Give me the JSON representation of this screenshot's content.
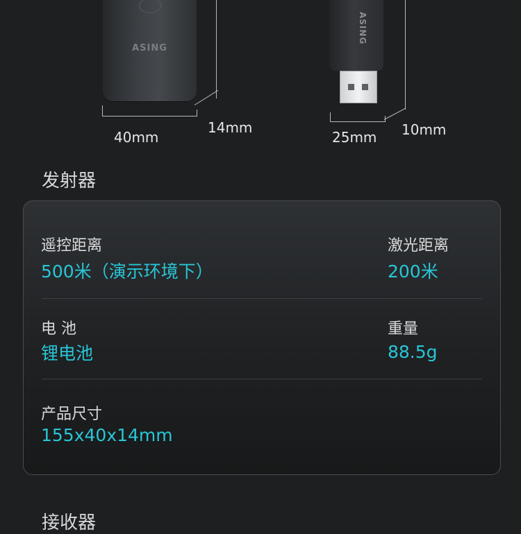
{
  "product": {
    "transmitter_logo": "ASING",
    "receiver_logo": "ASING"
  },
  "dimensions": {
    "transmitter_width": "40mm",
    "transmitter_depth": "14mm",
    "receiver_width": "25mm",
    "receiver_depth": "10mm"
  },
  "sections": {
    "transmitter_title": "发射器",
    "receiver_title": "接收器"
  },
  "specs": {
    "remote_range_label": "遥控距离",
    "remote_range_value": "500米（演示环境下）",
    "laser_range_label": "激光距离",
    "laser_range_value": "200米",
    "battery_label": "电 池",
    "battery_value": "锂电池",
    "weight_label": "重量",
    "weight_value": "88.5g",
    "size_label": "产品尺寸",
    "size_value": "155x40x14mm"
  },
  "colors": {
    "background": "#1d1f21",
    "accent": "#29c6d6",
    "label": "#d9dadb"
  }
}
